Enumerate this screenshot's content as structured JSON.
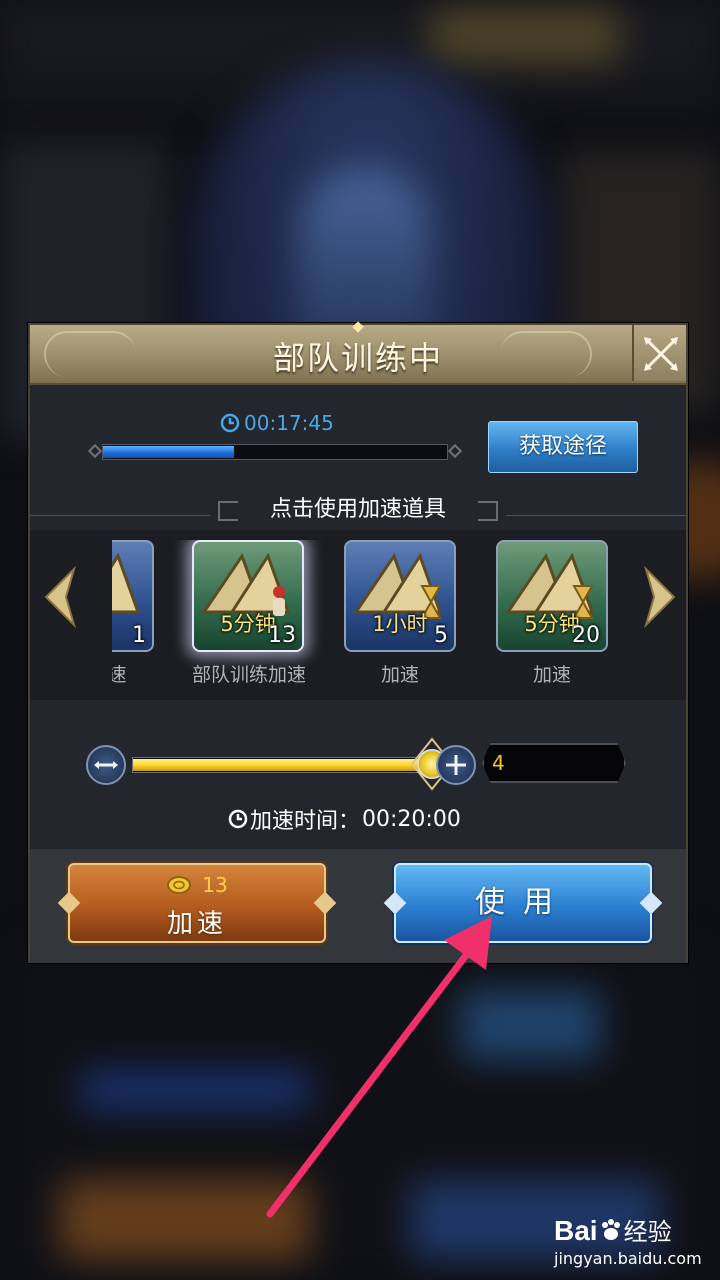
{
  "dialog": {
    "title": "部队训练中",
    "timer": "00:17:45",
    "progress_fraction": 0.38,
    "get_source_label": "获取途径",
    "section_label": "点击使用加速道具"
  },
  "items": [
    {
      "duration": "时",
      "count": "1",
      "name": "练加速",
      "color": "blue"
    },
    {
      "duration": "5分钟",
      "count": "13",
      "name": "部队训练加速",
      "color": "green",
      "selected": true
    },
    {
      "duration": "1小时",
      "count": "5",
      "name": "加速",
      "color": "blue"
    },
    {
      "duration": "5分钟",
      "count": "20",
      "name": "加速",
      "color": "green"
    }
  ],
  "slider": {
    "value_fraction": 1.0,
    "quantity": "4"
  },
  "speed_time": {
    "label": "加速时间：",
    "value": "00:20:00"
  },
  "footer": {
    "speed_cost": "13",
    "speed_label": "加速",
    "use_label": "使用"
  },
  "watermark": {
    "brand": "Bai",
    "brand_suffix": "经验",
    "url": "jingyan.baidu.com"
  },
  "colors": {
    "accent_blue": "#2f7fc8",
    "accent_orange": "#b45c1f",
    "timer_blue": "#48a6ea",
    "pointer_pink": "#f0306a"
  }
}
